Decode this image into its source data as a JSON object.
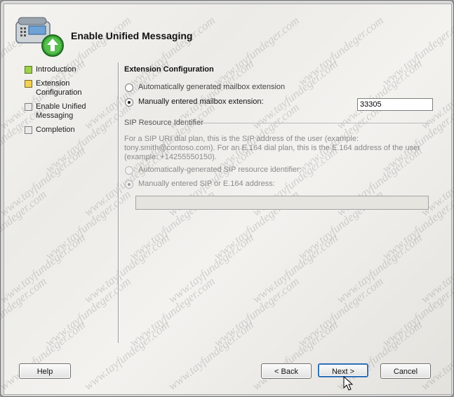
{
  "header": {
    "title": "Enable Unified Messaging",
    "icon": "phone-with-green-arrow-icon"
  },
  "nav": {
    "items": [
      {
        "label": "Introduction",
        "state": "done"
      },
      {
        "label": "Extension Configuration",
        "state": "active"
      },
      {
        "label": "Enable Unified Messaging",
        "state": "todo"
      },
      {
        "label": "Completion",
        "state": "todo"
      }
    ]
  },
  "extension": {
    "section_title": "Extension Configuration",
    "auto_label": "Automatically generated mailbox extension",
    "manual_label": "Manually entered mailbox extension:",
    "value": "33305",
    "selected": "manual"
  },
  "sip": {
    "group_title": "SIP Resource Identifier",
    "description": "For a SIP URI dial plan, this is the SIP address of the user (example: tony.smith@contoso.com). For an E.164 dial plan, this is the E.164 address of the user (example: +14255550150).",
    "auto_label": "Automatically-generated SIP resource identifier:",
    "manual_label": "Manually entered SIP or E.164 address:",
    "value": "",
    "selected": "manual",
    "enabled": false
  },
  "buttons": {
    "help": "Help",
    "back": "< Back",
    "next": "Next >",
    "cancel": "Cancel"
  },
  "watermark": "www.tayfundeger.com",
  "colors": {
    "accent_focus": "#2f6fb7",
    "step_done": "#9fd149",
    "step_active": "#f3d153"
  }
}
